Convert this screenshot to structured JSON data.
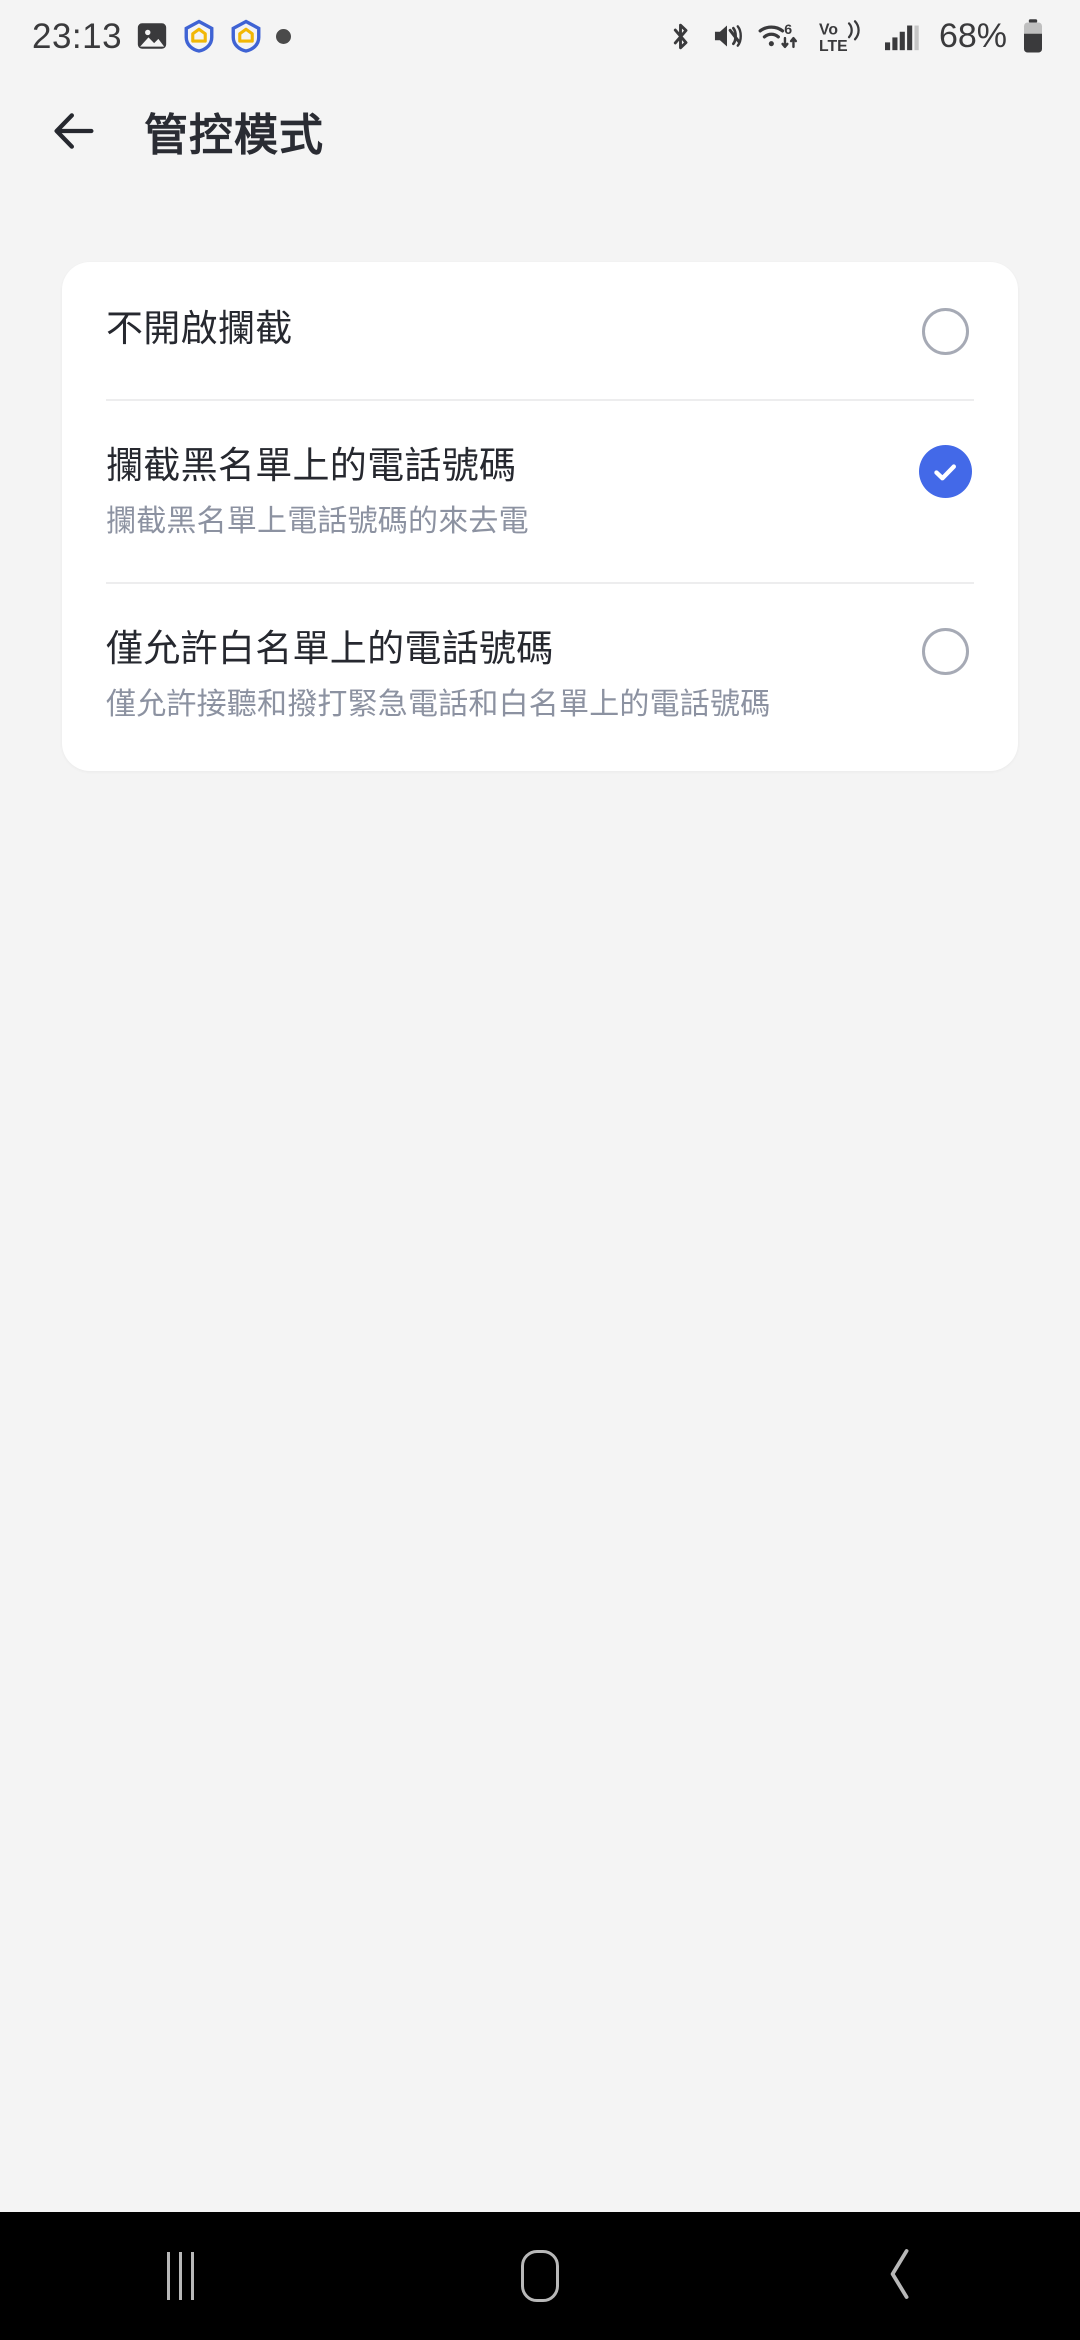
{
  "status_bar": {
    "time": "23:13",
    "left_icons": [
      "image-icon",
      "shield-app-icon",
      "shield-app-icon",
      "dot-indicator"
    ],
    "right_icons": [
      "bluetooth-icon",
      "mute-vibrate-icon",
      "wifi-6-icon",
      "volte-icon",
      "signal-bars-icon"
    ],
    "wifi_label": "6",
    "volte_label_top": "Vo))",
    "volte_label_bottom": "LTE",
    "battery_percent": "68%"
  },
  "app_bar": {
    "back_label": "back-arrow",
    "title": "管控模式"
  },
  "options": [
    {
      "title": "不開啟攔截",
      "subtitle": "",
      "selected": false,
      "name": "option-no-blocking"
    },
    {
      "title": "攔截黑名單上的電話號碼",
      "subtitle": "攔截黑名單上電話號碼的來去電",
      "selected": true,
      "name": "option-block-blacklist"
    },
    {
      "title": "僅允許白名單上的電話號碼",
      "subtitle": "僅允許接聽和撥打緊急電話和白名單上的電話號碼",
      "selected": false,
      "name": "option-allow-whitelist"
    }
  ],
  "nav_bar": {
    "recents_label": "recents-button",
    "home_label": "home-button",
    "back_label": "back-button"
  },
  "colors": {
    "accent_blue": "#4369E8",
    "page_bg": "#F4F4F4",
    "card_bg": "#FFFFFF",
    "title_text": "#26282F",
    "subtitle_text": "#8C92A1",
    "radio_outline": "#A6AAB5",
    "nav_bg": "#000000"
  }
}
